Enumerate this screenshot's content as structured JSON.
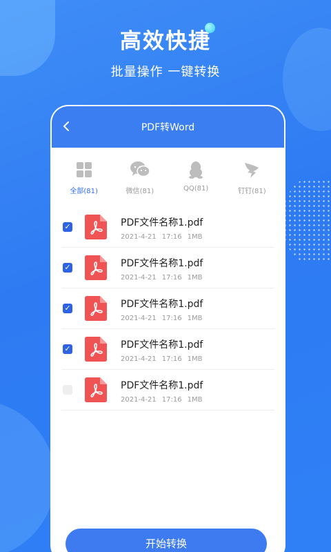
{
  "hero": {
    "title": "高效快捷",
    "subtitle": "批量操作 一键转换"
  },
  "phone": {
    "title": "PDF转Word",
    "back_icon": "chevron-left-icon"
  },
  "tabs": [
    {
      "label": "全部(81)",
      "icon": "grid-icon",
      "active": true
    },
    {
      "label": "微信(81)",
      "icon": "wechat-icon",
      "active": false
    },
    {
      "label": "QQ(81)",
      "icon": "qq-penguin-icon",
      "active": false
    },
    {
      "label": "钉钉(81)",
      "icon": "dingtalk-icon",
      "active": false
    }
  ],
  "files": [
    {
      "name": "PDF文件名称1.pdf",
      "date": "2021-4-21",
      "time": "17:16",
      "size": "1MB",
      "checked": true
    },
    {
      "name": "PDF文件名称1.pdf",
      "date": "2021-4-21",
      "time": "17:16",
      "size": "1MB",
      "checked": true
    },
    {
      "name": "PDF文件名称1.pdf",
      "date": "2021-4-21",
      "time": "17:16",
      "size": "1MB",
      "checked": true
    },
    {
      "name": "PDF文件名称1.pdf",
      "date": "2021-4-21",
      "time": "17:16",
      "size": "1MB",
      "checked": true
    },
    {
      "name": "PDF文件名称1.pdf",
      "date": "2021-4-21",
      "time": "17:16",
      "size": "1MB",
      "checked": false
    }
  ],
  "start_button": "开始转换",
  "colors": {
    "brand_blue": "#3b7ef1",
    "checkbox_blue": "#2f63e6",
    "pdf_red": "#ef5353"
  }
}
